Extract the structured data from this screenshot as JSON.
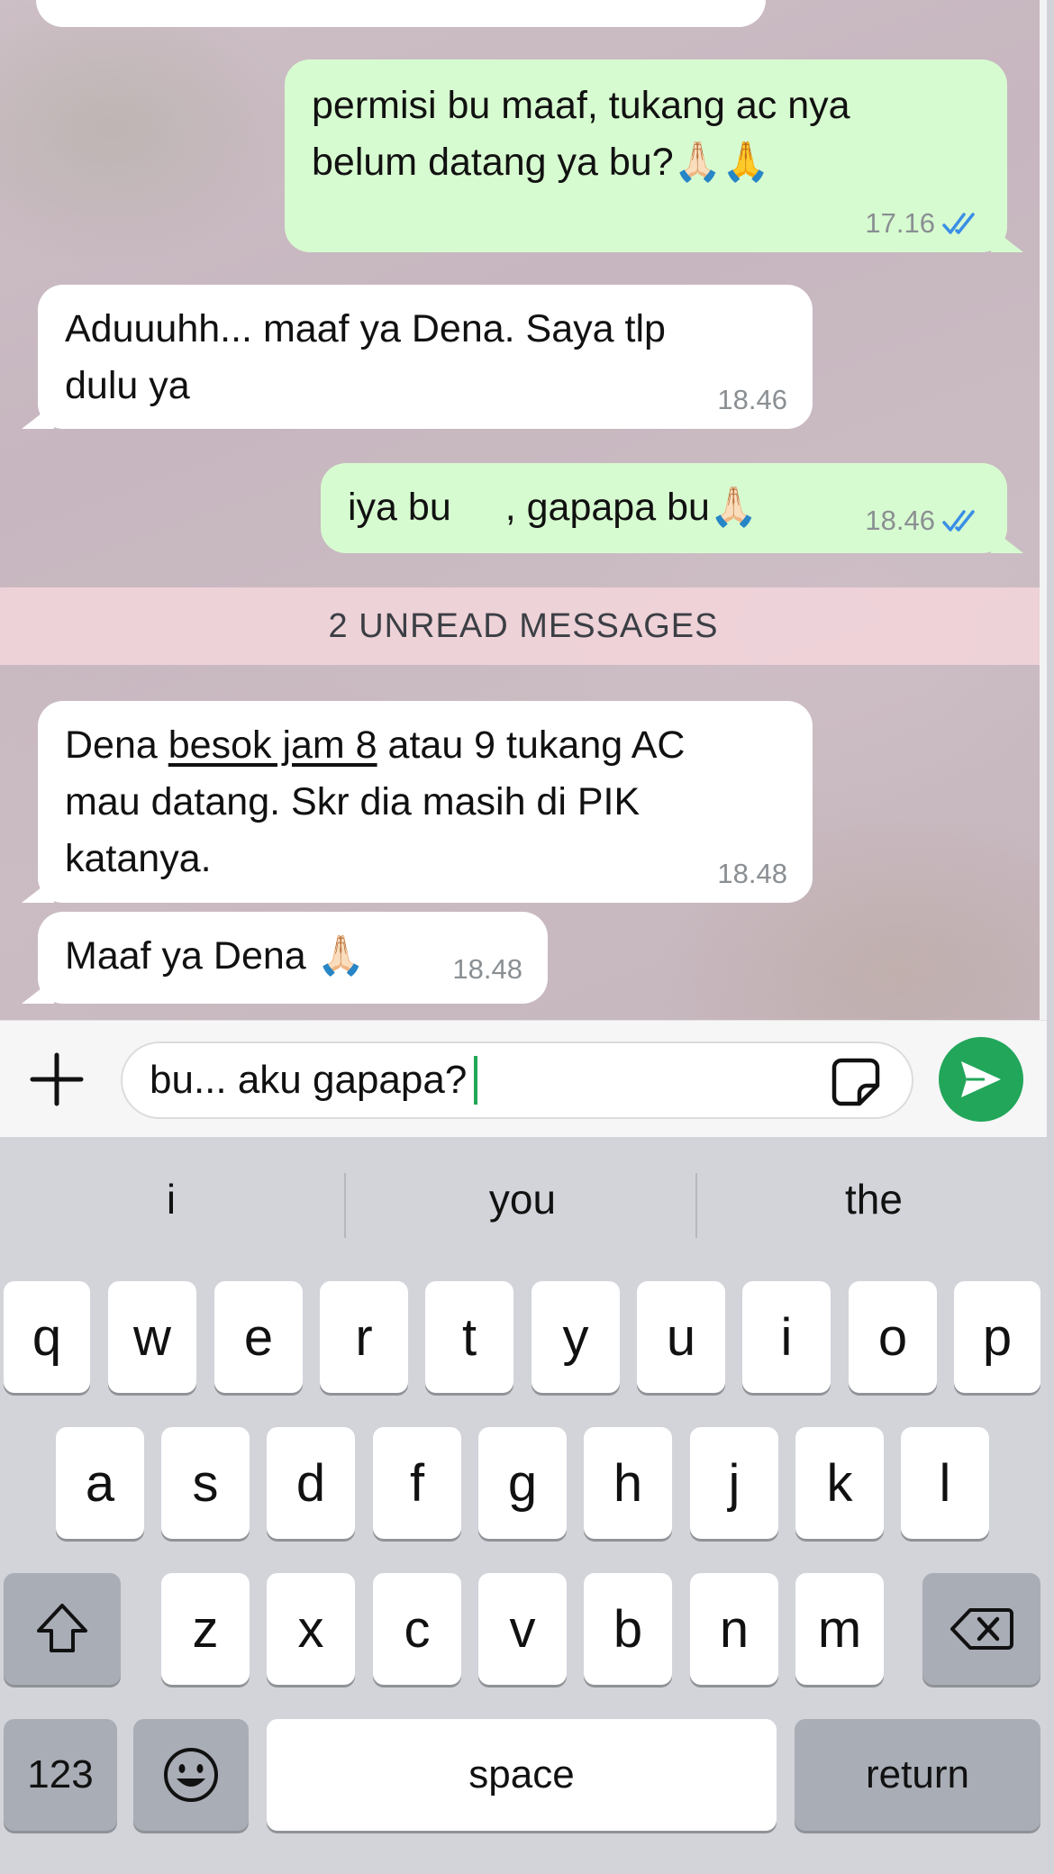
{
  "messages": [
    {
      "dir": "out",
      "text_line1": "permisi bu maaf, tukang ac nya",
      "text_line2": "belum datang ya bu?🙏🏻🙏",
      "time": "17.16"
    },
    {
      "dir": "in",
      "text_line1": "Aduuuhh... maaf ya Dena. Saya tlp",
      "text_line2": "dulu ya",
      "time": "18.46"
    },
    {
      "dir": "out",
      "text_a": "iya bu",
      "text_b": ", gapapa bu🙏🏻",
      "time": "18.46"
    },
    {
      "dir": "in",
      "text_pre": "Dena ",
      "text_link": "besok jam 8",
      "text_post": " atau 9 tukang AC",
      "text_line2": "mau datang. Skr dia masih di PIK",
      "text_line3": "katanya.",
      "time": "18.48"
    },
    {
      "dir": "in",
      "text": "Maaf ya Dena 🙏🏻",
      "time": "18.48"
    }
  ],
  "unread_banner": "2 UNREAD MESSAGES",
  "input": {
    "value": "bu... aku gapapa?"
  },
  "suggestions": [
    "i",
    "you",
    "the"
  ],
  "keys": {
    "row1": [
      "q",
      "w",
      "e",
      "r",
      "t",
      "y",
      "u",
      "i",
      "o",
      "p"
    ],
    "row2": [
      "a",
      "s",
      "d",
      "f",
      "g",
      "h",
      "j",
      "k",
      "l"
    ],
    "row3": [
      "z",
      "x",
      "c",
      "v",
      "b",
      "n",
      "m"
    ],
    "numbers": "123",
    "space": "space",
    "return": "return"
  },
  "colors": {
    "outgoing": "#d7fbd0",
    "incoming": "#ffffff",
    "send": "#22a65a",
    "ticks": "#3a8ee6"
  },
  "icons": [
    "plus-icon",
    "sticker-icon",
    "send-icon",
    "double-check-icon",
    "shift-icon",
    "backspace-icon",
    "emoji-icon"
  ]
}
